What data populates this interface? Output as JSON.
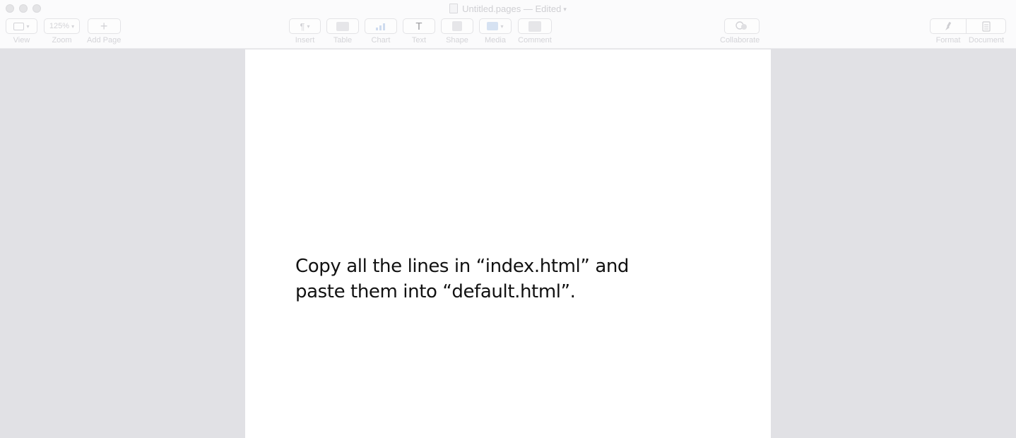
{
  "window": {
    "title": "Untitled.pages",
    "status": "— Edited"
  },
  "toolbar": {
    "zoom_value": "125%",
    "view_label": "View",
    "zoom_label": "Zoom",
    "add_page_label": "Add Page",
    "insert_label": "Insert",
    "table_label": "Table",
    "chart_label": "Chart",
    "text_label": "Text",
    "shape_label": "Shape",
    "media_label": "Media",
    "comment_label": "Comment",
    "collaborate_label": "Collaborate",
    "format_label": "Format",
    "document_label": "Document"
  },
  "icons": {
    "view": "sidebar-view-icon",
    "add_page": "plus-icon",
    "insert": "pilcrow-icon",
    "table": "table-icon",
    "chart": "bar-chart-icon",
    "text": "text-t-icon",
    "shape": "shape-icon",
    "media": "image-icon",
    "comment": "comment-icon",
    "collaborate": "people-icon",
    "format": "paintbrush-icon",
    "document": "document-icon"
  },
  "document": {
    "lines": [
      "Copy all the lines in “index.html” and",
      "paste them into “default.html”."
    ]
  },
  "colors": {
    "canvas_background": "#e1e1e5",
    "page_background": "#ffffff",
    "text": "#111111"
  }
}
